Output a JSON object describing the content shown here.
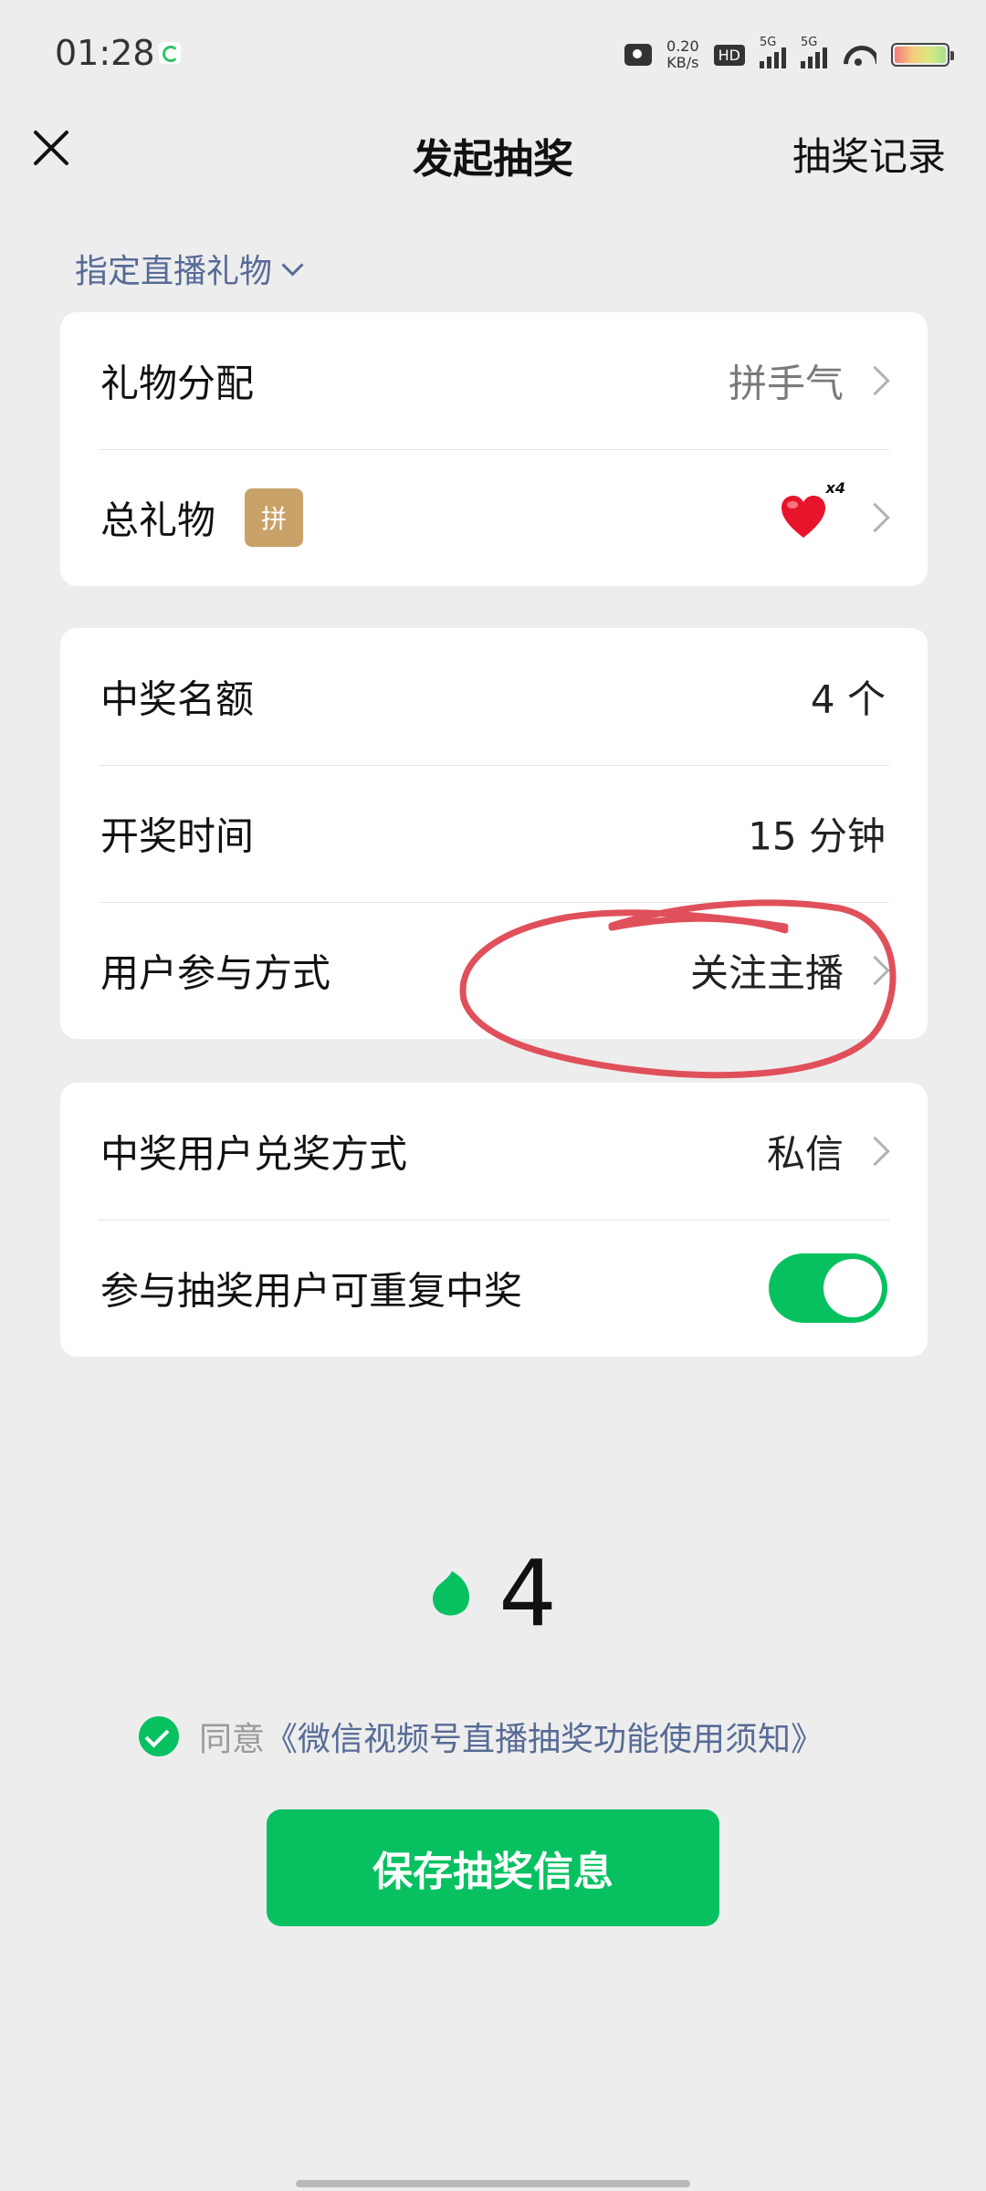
{
  "status_bar": {
    "time": "01:28",
    "net_speed_value": "0.20",
    "net_speed_unit": "KB/s",
    "hd_label": "HD",
    "signal_1_label": "5G",
    "signal_2_label": "5G"
  },
  "nav": {
    "title": "发起抽奖",
    "right_action": "抽奖记录"
  },
  "prize_type": {
    "label": "指定直播礼物"
  },
  "gift_card": {
    "distribution_label": "礼物分配",
    "distribution_value": "拼手气",
    "total_label": "总礼物",
    "total_badge": "拼",
    "gift_multiplier": "x4"
  },
  "settings_card": {
    "winners_label": "中奖名额",
    "winners_value": "4 个",
    "draw_time_label": "开奖时间",
    "draw_time_value": "15 分钟",
    "participation_label": "用户参与方式",
    "participation_value": "关注主播"
  },
  "redeem_card": {
    "redeem_label": "中奖用户兑奖方式",
    "redeem_value": "私信",
    "repeat_win_label": "参与抽奖用户可重复中奖",
    "repeat_win_enabled": true
  },
  "coin_count": "4",
  "agreement": {
    "prefix": "同意",
    "link": "《微信视频号直播抽奖功能使用须知》",
    "checked": true
  },
  "save_button": "保存抽奖信息",
  "colors": {
    "accent_green": "#07c160",
    "link_blue": "#576b95",
    "badge_gold": "#c8a268",
    "annotation_red": "#e0505a",
    "background": "#ededed"
  }
}
